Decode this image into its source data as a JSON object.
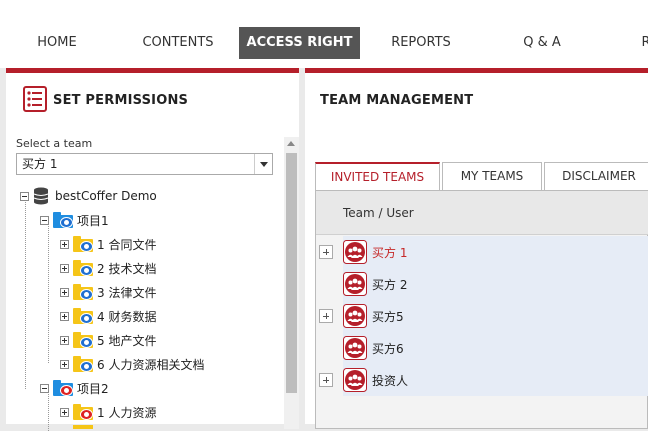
{
  "nav": {
    "items": [
      {
        "label": "HOME",
        "active": false
      },
      {
        "label": "CONTENTS",
        "active": false
      },
      {
        "label": "ACCESS RIGHT",
        "active": true
      },
      {
        "label": "REPORTS",
        "active": false
      },
      {
        "label": "Q & A",
        "active": false
      },
      {
        "label": "R",
        "active": false
      }
    ]
  },
  "left": {
    "title": "SET PERMISSIONS",
    "select_label": "Select a team",
    "selected_team": "买方 1",
    "tree": {
      "root": "bestCoffer Demo",
      "project1": "项目1",
      "project1_items": [
        "1 合同文件",
        "2 技术文档",
        "3 法律文件",
        "4 财务数据",
        "5 地产文件",
        "6 人力资源相关文档"
      ],
      "project2": "项目2",
      "project2_items": [
        "1 人力资源"
      ]
    }
  },
  "right": {
    "title": "TEAM MANAGEMENT",
    "tabs": [
      {
        "label": "INVITED TEAMS",
        "active": true
      },
      {
        "label": "MY TEAMS",
        "active": false
      },
      {
        "label": "DISCLAIMER",
        "active": false
      }
    ],
    "column_header": "Team / User",
    "teams": [
      {
        "name": "买方 1",
        "expandable": true,
        "selected": true
      },
      {
        "name": "买方 2",
        "expandable": false,
        "selected": false
      },
      {
        "name": "买方5",
        "expandable": true,
        "selected": false
      },
      {
        "name": "买方6",
        "expandable": false,
        "selected": false
      },
      {
        "name": "投资人",
        "expandable": true,
        "selected": false
      }
    ]
  },
  "colors": {
    "accent": "#b51f2a",
    "nav_active_bg": "#555555",
    "folder": "#f5c518",
    "eye": "#1f6fd1"
  }
}
